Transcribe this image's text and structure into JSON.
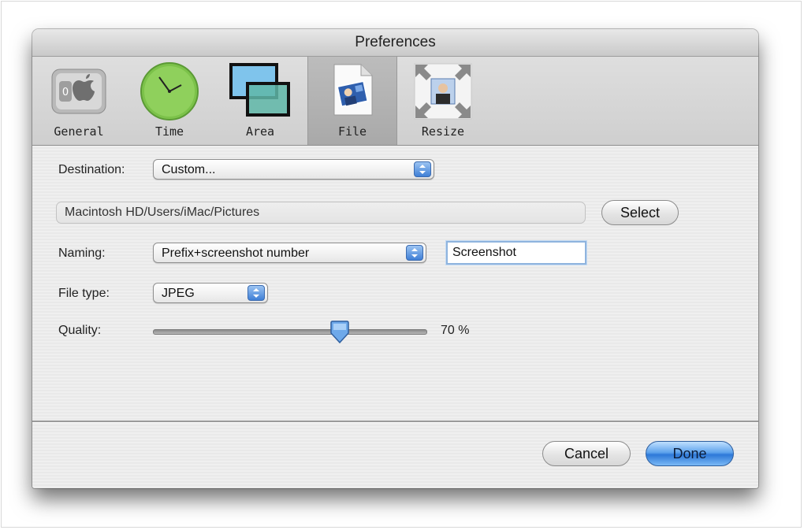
{
  "window": {
    "title": "Preferences"
  },
  "toolbar": {
    "items": [
      {
        "label": "General",
        "icon": "general-switch-icon"
      },
      {
        "label": "Time",
        "icon": "clock-icon"
      },
      {
        "label": "Area",
        "icon": "area-icon"
      },
      {
        "label": "File",
        "icon": "file-icon",
        "selected": true
      },
      {
        "label": "Resize",
        "icon": "resize-icon"
      }
    ]
  },
  "form": {
    "destination": {
      "label": "Destination:",
      "value": "Custom..."
    },
    "path": {
      "value": "Macintosh HD/Users/iMac/Pictures"
    },
    "select_button": "Select",
    "naming": {
      "label": "Naming:",
      "value": "Prefix+screenshot number",
      "prefix_value": "Screenshot"
    },
    "file_type": {
      "label": "File type:",
      "value": "JPEG"
    },
    "quality": {
      "label": "Quality:",
      "value": 70,
      "display": "70 %"
    }
  },
  "buttons": {
    "cancel": "Cancel",
    "done": "Done"
  },
  "colors": {
    "accent": "#3f7fd6",
    "time_icon": "#7cc24a"
  }
}
